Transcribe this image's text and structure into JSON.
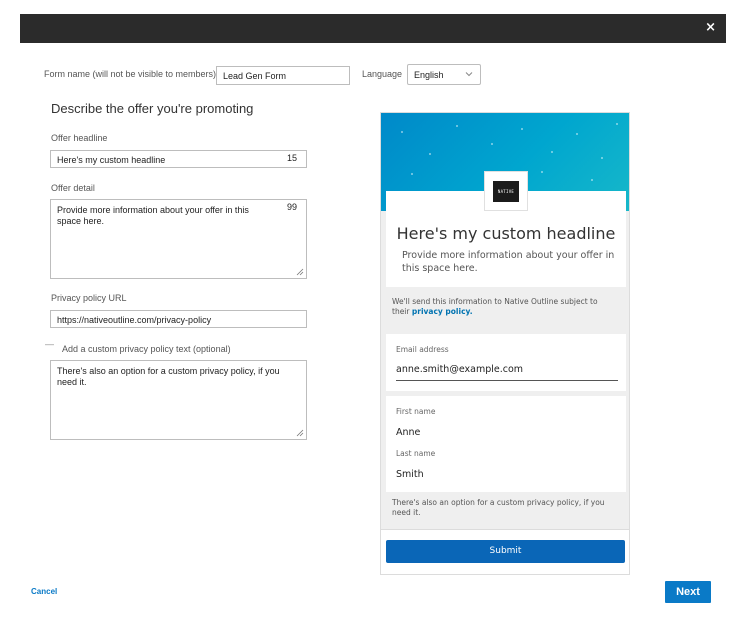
{
  "modal": {
    "close_glyph": "×"
  },
  "form": {
    "name_label": "Form name (will not be visible to members)",
    "name_value": "Lead Gen Form",
    "language_label": "Language",
    "language_value": "English",
    "section_title": "Describe the offer you're promoting",
    "headline_label": "Offer headline",
    "headline_value": "Here's my custom headline",
    "headline_remaining": "15",
    "detail_label": "Offer detail",
    "detail_value": "Provide more information about your offer in this space here.",
    "detail_remaining": "99",
    "privacy_label": "Privacy policy URL",
    "privacy_value": "https://nativeoutline.com/privacy-policy",
    "custom_privacy_toggle": "—",
    "custom_privacy_label": "Add a custom privacy policy text (optional)",
    "custom_privacy_value": "There's also an option for a custom privacy policy, if you need it."
  },
  "preview": {
    "logo_text": "NATIVE",
    "headline": "Here's my custom headline",
    "detail": "Provide more information about your offer in this space here.",
    "notice_prefix": "We'll send this information to Native Outline subject to their",
    "notice_link": "privacy policy.",
    "email_label": "Email address",
    "email_value": "anne.smith@example.com",
    "first_name_label": "First name",
    "first_name_value": "Anne",
    "last_name_label": "Last name",
    "last_name_value": "Smith",
    "custom_privacy": "There's also an option for a custom privacy policy, if you need it.",
    "submit_label": "Submit"
  },
  "footer": {
    "cancel_label": "Cancel",
    "next_label": "Next"
  },
  "colors": {
    "accent": "#0a7ac7",
    "submit": "#0a66b7",
    "topbar": "#2b2b2b",
    "link": "#0073b1"
  },
  "icons": [
    "close-icon",
    "chevron-down-icon",
    "resize-handle-icon",
    "collapse-icon"
  ]
}
